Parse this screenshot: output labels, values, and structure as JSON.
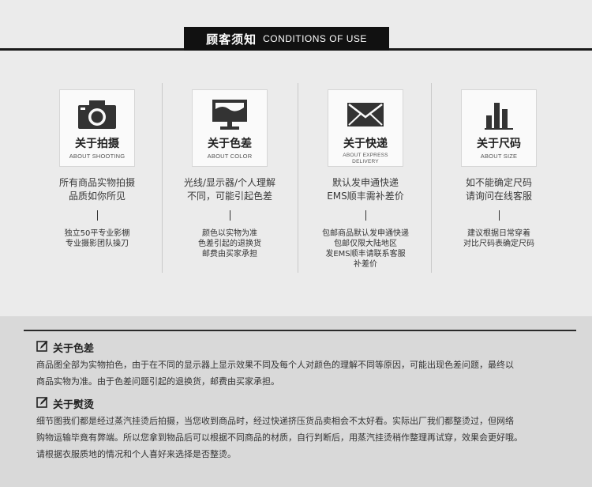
{
  "header": {
    "title_cn": "顾客须知",
    "title_en": "CONDITIONS OF USE"
  },
  "columns": [
    {
      "icon": "camera-icon",
      "title": "关于拍摄",
      "subtitle": "ABOUT SHOOTING",
      "desc_lines": [
        "所有商品实物拍摄",
        "品质如你所见"
      ],
      "detail_lines": [
        "独立50平专业影棚",
        "专业摄影团队操刀"
      ]
    },
    {
      "icon": "monitor-icon",
      "title": "关于色差",
      "subtitle": "ABOUT COLOR",
      "desc_lines": [
        "光线/显示器/个人理解",
        "不同，可能引起色差"
      ],
      "detail_lines": [
        "颜色以实物为准",
        "色差引起的退换货",
        "邮费由买家承担"
      ]
    },
    {
      "icon": "envelope-icon",
      "title": "关于快递",
      "subtitle": "ABOUT EXPRESS DELIVERY",
      "desc_lines": [
        "默认发申通快递",
        "EMS顺丰需补差价"
      ],
      "detail_lines": [
        "包邮商品默认发申通快递",
        "包邮仅限大陆地区",
        "发EMS顺丰请联系客服",
        "补差价"
      ]
    },
    {
      "icon": "bar-chart-icon",
      "title": "关于尺码",
      "subtitle": "ABOUT SIZE",
      "desc_lines": [
        "如不能确定尺码",
        "请询问在线客服"
      ],
      "detail_lines": [
        "建议根据日常穿着",
        "对比尺码表确定尺码"
      ]
    }
  ],
  "notes": [
    {
      "icon": "edit-icon",
      "heading": "关于色差",
      "lines": [
        "商品图全部为实物拍色，由于在不同的显示器上显示效果不同及每个人对颜色的理解不同等原因，可能出现色差问题，最终以",
        "商品实物为准。由于色差问题引起的退换货，邮费由买家承担。"
      ]
    },
    {
      "icon": "edit-icon",
      "heading": "关于熨烫",
      "lines": [
        "细节图我们都是经过蒸汽挂烫后拍摄，当您收到商品时，经过快递挤压货品卖相会不太好看。实际出厂我们都整烫过，但网络",
        "购物运输毕竟有弊端。所以您拿到物品后可以根据不同商品的材质，自行判断后，用蒸汽挂烫稍作整理再试穿，效果会更好哦。",
        "请根据衣服质地的情况和个人喜好来选择是否整烫。"
      ]
    }
  ]
}
